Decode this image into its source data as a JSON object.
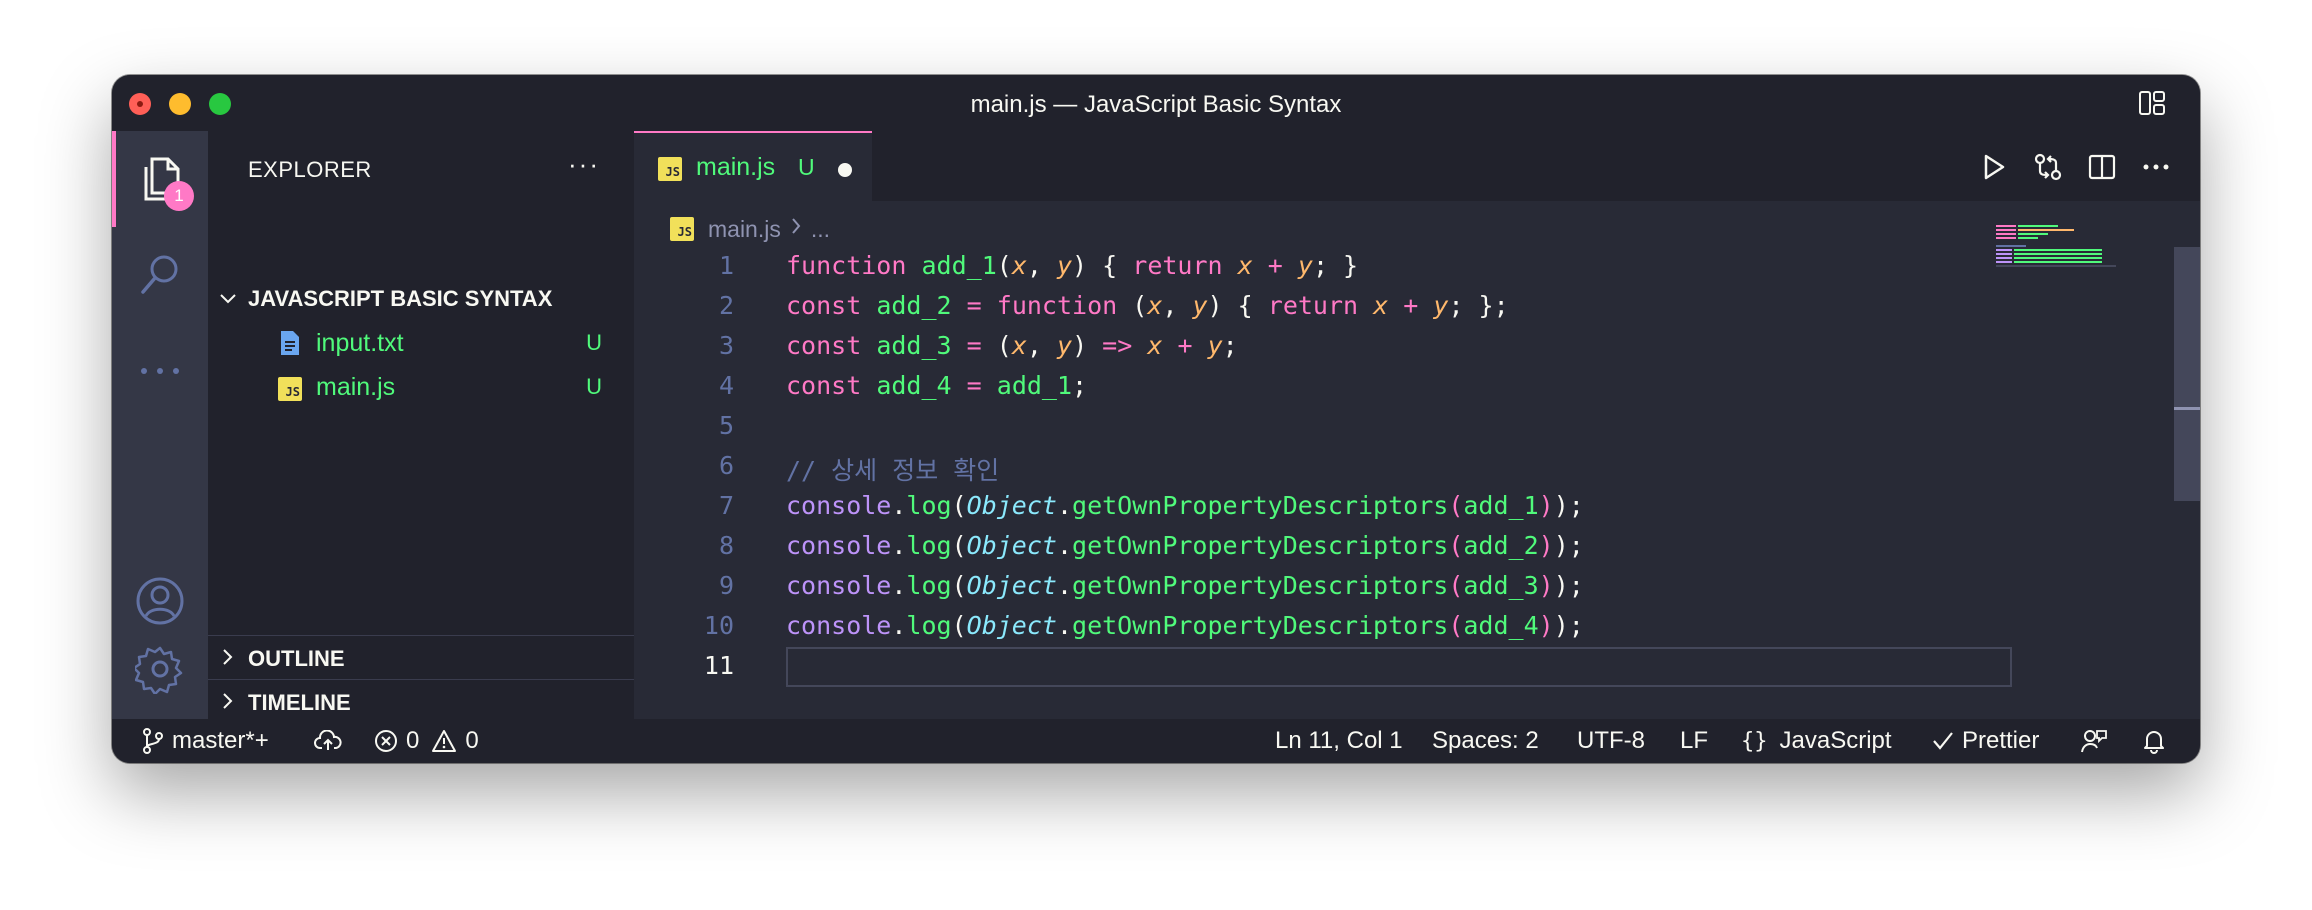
{
  "window": {
    "title": "main.js — JavaScript Basic Syntax"
  },
  "activity_bar": {
    "explorer_badge": "1",
    "items": [
      "explorer-icon",
      "search-icon",
      "more-icon",
      "account-icon",
      "settings-gear-icon"
    ]
  },
  "sidebar": {
    "header": "EXPLORER",
    "more": "···",
    "project": "JAVASCRIPT BASIC SYNTAX",
    "files": [
      {
        "name": "input.txt",
        "status": "U",
        "icon": "text-file-icon"
      },
      {
        "name": "main.js",
        "status": "U",
        "icon": "js-file-icon"
      }
    ],
    "outline": "OUTLINE",
    "timeline": "TIMELINE"
  },
  "editor": {
    "tab": {
      "label": "main.js",
      "status": "U",
      "icon_text": "JS"
    },
    "breadcrumb": {
      "file": "main.js",
      "rest": "..."
    },
    "current_line": 11
  },
  "code": {
    "line_numbers": [
      "1",
      "2",
      "3",
      "4",
      "5",
      "6",
      "7",
      "8",
      "9",
      "10",
      "11"
    ],
    "comment": "// 상세 정보 확인"
  },
  "status_bar": {
    "branch": "master*+",
    "errors": "0",
    "warnings": "0",
    "cursor": "Ln 11, Col 1",
    "spaces": "Spaces: 2",
    "encoding": "UTF-8",
    "eol": "LF",
    "language": "JavaScript",
    "formatter": "Prettier"
  },
  "colors": {
    "keyword": "#ff79c6",
    "function": "#50fa7b",
    "param": "#ffb86c",
    "comment": "#6272a4",
    "class": "#8be9fd",
    "console": "#bd93f9",
    "accent": "#ff79c6"
  }
}
